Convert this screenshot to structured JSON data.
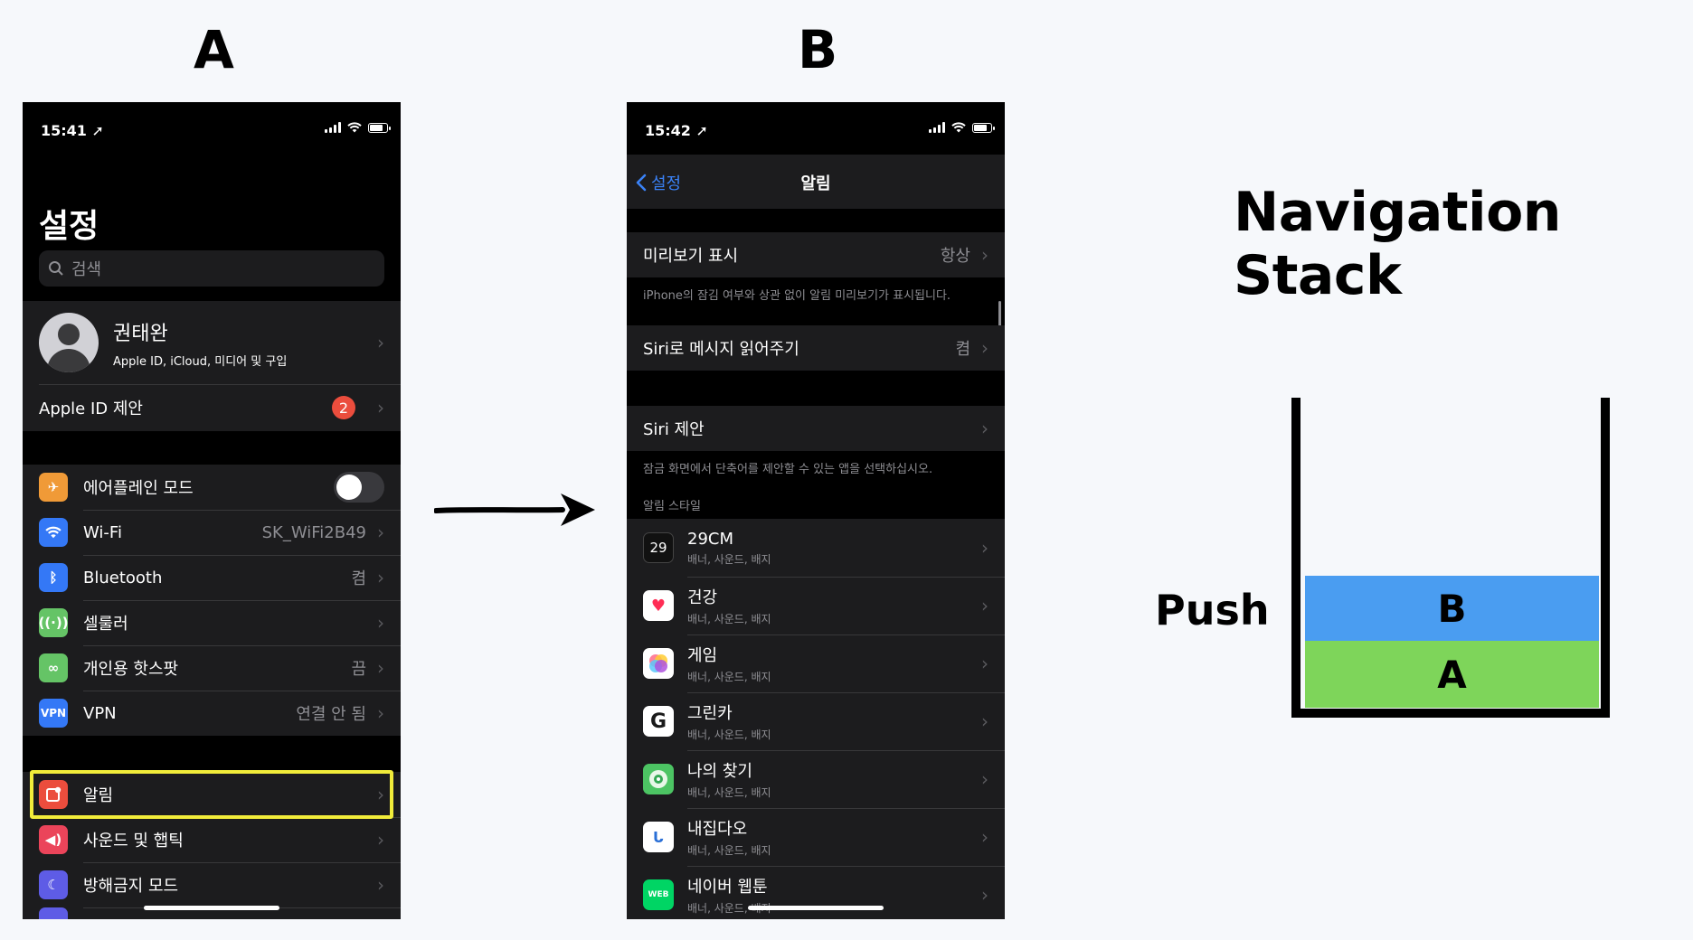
{
  "labels": {
    "a": "A",
    "b": "B"
  },
  "phone_a": {
    "status_time": "15:41",
    "title": "설정",
    "search_placeholder": "검색",
    "profile": {
      "name": "권태완",
      "subtitle": "Apple ID, iCloud, 미디어 및 구입"
    },
    "apple_id_suggestion": {
      "label": "Apple ID 제안",
      "badge": "2"
    },
    "network_rows": [
      {
        "label": "에어플레인 모드",
        "value": "",
        "icon": "airplane-icon",
        "color": "#f09a37"
      },
      {
        "label": "Wi-Fi",
        "value": "SK_WiFi2B49",
        "icon": "wifi-icon",
        "color": "#3478f6"
      },
      {
        "label": "Bluetooth",
        "value": "켬",
        "icon": "bluetooth-icon",
        "color": "#3478f6"
      },
      {
        "label": "셀룰러",
        "value": "",
        "icon": "cellular-icon",
        "color": "#65c466"
      },
      {
        "label": "개인용 핫스팟",
        "value": "끔",
        "icon": "hotspot-icon",
        "color": "#65c466"
      },
      {
        "label": "VPN",
        "value": "연결 안 됨",
        "icon": "vpn-icon",
        "color": "#3478f6"
      }
    ],
    "vpn_icon_text": "VPN",
    "notification_rows": [
      {
        "label": "알림",
        "icon": "notifications-icon",
        "color": "#eb4d3d"
      },
      {
        "label": "사운드 및 햅틱",
        "icon": "sound-icon",
        "color": "#eb445a"
      },
      {
        "label": "방해금지 모드",
        "icon": "moon-icon",
        "color": "#5e5ce6"
      }
    ]
  },
  "phone_b": {
    "status_time": "15:42",
    "back_label": "설정",
    "title": "알림",
    "preview": {
      "label": "미리보기 표시",
      "value": "항상"
    },
    "preview_footer": "iPhone의 잠김 여부와 상관 없이 알림 미리보기가 표시됩니다.",
    "siri_read": {
      "label": "Siri로 메시지 읽어주기",
      "value": "켬"
    },
    "siri_suggest": {
      "label": "Siri 제안"
    },
    "siri_footer": "잠금 화면에서 단축어를 제안할 수 있는 앱을 선택하십시오.",
    "style_header": "알림 스타일",
    "apps": [
      {
        "name": "29CM",
        "sub": "배너, 사운드, 배지",
        "icon_text": "29",
        "icon": "29cm-icon",
        "color": "#111111"
      },
      {
        "name": "건강",
        "sub": "배너, 사운드, 배지",
        "icon_text": "♥",
        "icon": "health-icon",
        "color": "#ffffff"
      },
      {
        "name": "게임",
        "sub": "배너, 사운드, 배지",
        "icon_text": "",
        "icon": "game-center-icon",
        "color": "#ffffff"
      },
      {
        "name": "그린카",
        "sub": "배너, 사운드, 배지",
        "icon_text": "G",
        "icon": "greencar-icon",
        "color": "#ffffff"
      },
      {
        "name": "나의 찾기",
        "sub": "배너, 사운드, 배지",
        "icon_text": "",
        "icon": "find-my-icon",
        "color": "#4cc463"
      },
      {
        "name": "내집다오",
        "sub": "배너, 사운드, 배지",
        "icon_text": "ᒐ",
        "icon": "naejipdao-icon",
        "color": "#ffffff"
      },
      {
        "name": "네이버 웹툰",
        "sub": "배너, 사운드, 배지",
        "icon_text": "WEB",
        "icon": "naver-webtoon-icon",
        "color": "#00d564"
      }
    ]
  },
  "diagram": {
    "title": "Navigation Stack",
    "push_label": "Push",
    "stack": [
      {
        "label": "B",
        "color": "#4a9df1"
      },
      {
        "label": "A",
        "color": "#7ed55a"
      }
    ]
  }
}
